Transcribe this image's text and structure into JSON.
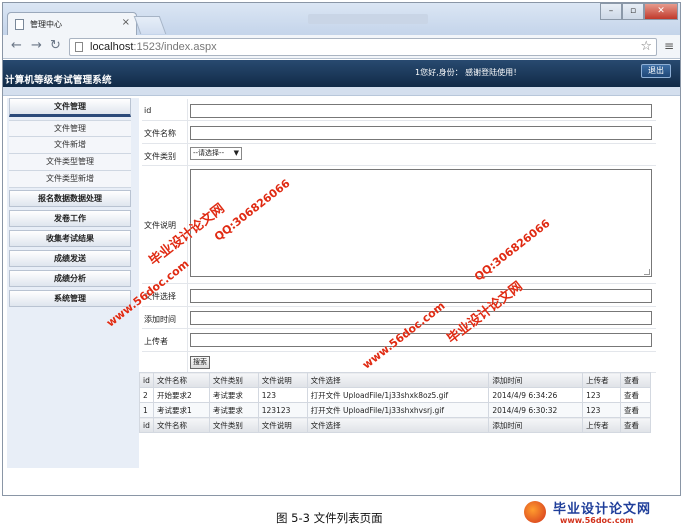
{
  "browser": {
    "tab_title": "管理中心",
    "tab_close": "×",
    "url_host": "localhost",
    "url_path": ":1523/index.aspx"
  },
  "header": {
    "system_title": "计算机等级考试管理系统",
    "welcome": "1您好,身份：  感谢登陆使用！",
    "logout_label": "退出"
  },
  "sidebar": {
    "sections": [
      {
        "label": "文件管理",
        "items": [
          "文件管理",
          "文件新增",
          "文件类型管理",
          "文件类型新增"
        ]
      },
      {
        "label": "报名数据数据处理",
        "items": []
      },
      {
        "label": "发卷工作",
        "items": []
      },
      {
        "label": "收集考试结果",
        "items": []
      },
      {
        "label": "成绩发送",
        "items": []
      },
      {
        "label": "成绩分析",
        "items": []
      },
      {
        "label": "系统管理",
        "items": []
      }
    ]
  },
  "form": {
    "id_label": "id",
    "name_label": "文件名称",
    "type_label": "文件类别",
    "type_selected": "--请选择--",
    "desc_label": "文件说明",
    "select_label": "文件选择",
    "time_label": "添加时间",
    "uploader_label": "上传者",
    "search_label": "搜索"
  },
  "table": {
    "columns": [
      "id",
      "文件名称",
      "文件类别",
      "文件说明",
      "文件选择",
      "添加时间",
      "上传者",
      "查看"
    ],
    "rows": [
      [
        "2",
        "开始要求2",
        "考试要求",
        "123",
        "打开文件 UploadFile/1j33shxk8oz5.gif",
        "2014/4/9 6:34:26",
        "123",
        "查看"
      ],
      [
        "1",
        "考试要求1",
        "考试要求",
        "123123",
        "打开文件 UploadFile/1j33shxhvsrj.gif",
        "2014/4/9 6:30:32",
        "123",
        "查看"
      ]
    ]
  },
  "watermarks": {
    "site_cn": "毕业设计论文网",
    "site_url": "www.56doc.com",
    "qq": "QQ:306826066"
  },
  "caption": "图 5-3  文件列表页面",
  "logo": {
    "name": "毕业设计论文网",
    "url": "www.56doc.com"
  }
}
